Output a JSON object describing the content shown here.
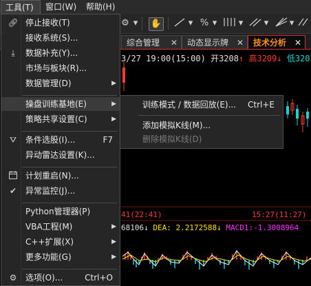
{
  "menubar": {
    "items": [
      {
        "label": "工具(T)"
      },
      {
        "label": "窗口(W)"
      },
      {
        "label": "帮助(H)"
      }
    ]
  },
  "tabs": [
    {
      "label": "综合管理"
    },
    {
      "label": "动态显示牌"
    },
    {
      "label": "技术分析"
    }
  ],
  "chart": {
    "header": {
      "time": "3/27 19:00(15:00)",
      "open_label": "开3208",
      "high_label": "高3209",
      "low_label": "低3207"
    },
    "time_left": "41(22:41)",
    "time_right": "15:27(11:27)",
    "indicator": {
      "dif_tail": "68106",
      "dea": "DEA: 2.2172588",
      "macd": "MACD1:-1.3008964"
    },
    "colors": {
      "up": "#ff3b30",
      "down": "#19d3d3",
      "price_line": "#ffffff",
      "signal_line": "#ffe400",
      "accent": "#ff8c1a"
    }
  },
  "tools_menu": {
    "items": [
      {
        "label": "停止接收(T)",
        "icon": "link-icon"
      },
      {
        "label": "接收系统(S)..."
      },
      {
        "label": "数据补充(Y)...",
        "icon": "download-icon"
      },
      {
        "label": "市场与板块(R)..."
      },
      {
        "label": "数据管理(D)"
      },
      {
        "label": "操盘训练基地(E)"
      },
      {
        "label": "策略共享设置(C)"
      },
      {
        "label": "条件选股(I)...",
        "icon": "filter-icon",
        "shortcut": "F7"
      },
      {
        "label": "异动雷达设置(K)..."
      },
      {
        "label": "计划重启(N)...",
        "icon": "calendar-icon"
      },
      {
        "label": "异常监控(J)...",
        "icon": "check-icon"
      },
      {
        "label": "Python管理器(P)"
      },
      {
        "label": "VBA工程(M)"
      },
      {
        "label": "C++扩展(X)"
      },
      {
        "label": "更多功能(G)"
      },
      {
        "label": "选项(O)...",
        "icon": "gear-icon",
        "shortcut": "Ctrl+O"
      }
    ]
  },
  "training_submenu": {
    "items": [
      {
        "label": "训练模式 / 数据回放(E)...",
        "shortcut": "Ctrl+E"
      },
      {
        "label": "添加模拟K线(M)..."
      },
      {
        "label": "删除模拟K线(D)",
        "disabled": true
      }
    ]
  }
}
